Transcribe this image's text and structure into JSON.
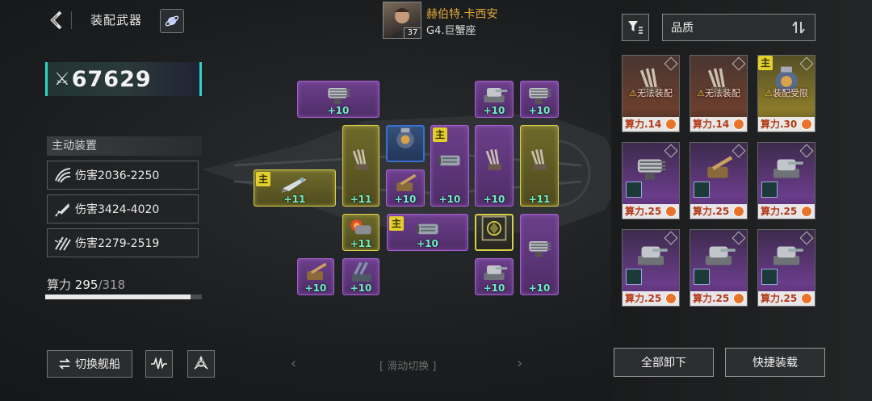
{
  "header": {
    "title": "装配武器"
  },
  "combat_power": "67629",
  "active_devices": {
    "label": "主动装置",
    "stats": [
      {
        "icon": "claw-icon",
        "text": "伤害2036-2250"
      },
      {
        "icon": "missile-icon",
        "text": "伤害3424-4020"
      },
      {
        "icon": "multi-missile-icon",
        "text": "伤害2279-2519"
      }
    ]
  },
  "compute": {
    "label": "算力",
    "current": "295",
    "max": "/318",
    "ratio": 0.9277
  },
  "pilot": {
    "name": "赫伯特.卡西安",
    "rank": "G4.巨蟹座",
    "level": "37"
  },
  "buttons": {
    "switch_ship": "切换舰船",
    "unequip_all": "全部卸下",
    "quick_equip": "快捷装载"
  },
  "swipe_hint": "滑动切换",
  "sort": {
    "label": "品质"
  },
  "slots": [
    {
      "name": "slot-gatling-top-wide",
      "rarity": "purple",
      "level": "+10",
      "main": false,
      "weapon": "gatling"
    },
    {
      "name": "slot-turret-top-1",
      "rarity": "purple",
      "level": "+10",
      "main": false,
      "weapon": "turret"
    },
    {
      "name": "slot-gatling-top-2",
      "rarity": "purple",
      "level": "+10",
      "main": false,
      "weapon": "gatling"
    },
    {
      "name": "slot-missile-main",
      "rarity": "gold",
      "level": "+11",
      "main": true,
      "main_label": "主",
      "weapon": "missile"
    },
    {
      "name": "slot-claw-tall-1",
      "rarity": "gold",
      "level": "+11",
      "main": false,
      "weapon": "claw"
    },
    {
      "name": "slot-core-blue",
      "rarity": "blue",
      "level": "",
      "main": false,
      "weapon": "core"
    },
    {
      "name": "slot-cannon-mid",
      "rarity": "purple",
      "level": "+10",
      "main": false,
      "weapon": "cannon"
    },
    {
      "name": "slot-heavy-main",
      "rarity": "purple",
      "level": "+10",
      "main": true,
      "main_label": "主",
      "weapon": "heavy"
    },
    {
      "name": "slot-claw-tall-2",
      "rarity": "purple",
      "level": "+10",
      "main": false,
      "weapon": "claw"
    },
    {
      "name": "slot-claw-tall-3",
      "rarity": "gold",
      "level": "+11",
      "main": false,
      "weapon": "claw"
    },
    {
      "name": "slot-flame-tall",
      "rarity": "gold",
      "level": "+11",
      "main": false,
      "weapon": "flame"
    },
    {
      "name": "slot-cannon-wide-main",
      "rarity": "purple",
      "level": "+10",
      "main": true,
      "main_label": "主",
      "weapon": "heavy"
    },
    {
      "name": "slot-shield-frame",
      "rarity": "goldframe",
      "level": "",
      "main": false,
      "weapon": "shield"
    },
    {
      "name": "slot-gatling-tall",
      "rarity": "purple",
      "level": "+10",
      "main": false,
      "weapon": "gatling"
    },
    {
      "name": "slot-cannon-bottom-1",
      "rarity": "purple",
      "level": "+10",
      "main": false,
      "weapon": "cannon"
    },
    {
      "name": "slot-artillery-bottom",
      "rarity": "purple",
      "level": "+10",
      "main": false,
      "weapon": "artillery"
    },
    {
      "name": "slot-turret-bottom",
      "rarity": "purple",
      "level": "+10",
      "main": false,
      "weapon": "turret"
    }
  ],
  "inventory": [
    {
      "rarity": "red",
      "cost": "算力.14",
      "warning": "无法装配",
      "main": false
    },
    {
      "rarity": "red",
      "cost": "算力.14",
      "warning": "无法装配",
      "main": false
    },
    {
      "rarity": "gold",
      "cost": "算力.30",
      "warning": "装配受限",
      "main": true,
      "main_label": "主"
    },
    {
      "rarity": "purple",
      "cost": "算力.25",
      "warning": "",
      "main": false
    },
    {
      "rarity": "purple",
      "cost": "算力.25",
      "warning": "",
      "main": false
    },
    {
      "rarity": "purple",
      "cost": "算力.25",
      "warning": "",
      "main": false
    },
    {
      "rarity": "purple",
      "cost": "算力.25",
      "warning": "",
      "main": false
    },
    {
      "rarity": "purple",
      "cost": "算力.25",
      "warning": "",
      "main": false
    },
    {
      "rarity": "purple",
      "cost": "算力.25",
      "warning": "",
      "main": false
    }
  ],
  "colors": {
    "accent_teal": "#2fd3c5",
    "purple_rarity": "#a45fd0",
    "gold_rarity": "#d8cf4a",
    "level_text": "#6ff0c8",
    "pilot_name": "#e3a93a",
    "cost_text": "#b23a18"
  }
}
